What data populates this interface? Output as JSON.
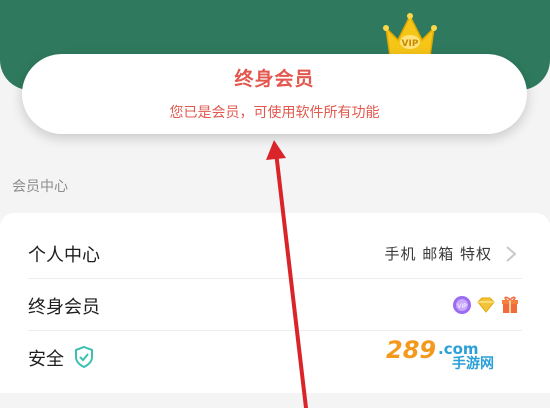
{
  "membership_card": {
    "title": "终身会员",
    "subtitle": "您已是会员，可使用软件所有功能"
  },
  "crown_badge": {
    "text": "VIP"
  },
  "section": {
    "label": "会员中心"
  },
  "rows": [
    {
      "label": "个人中心",
      "value": "手机 邮箱 特权",
      "icon": "chevron-right-icon"
    },
    {
      "label": "终身会员",
      "badges": [
        "vip-badge-icon",
        "diamond-badge-icon",
        "gift-badge-icon"
      ]
    },
    {
      "label": "安全",
      "icon": "shield-check-icon"
    }
  ],
  "watermark": {
    "logo_text": "289",
    "domain_text": ".com",
    "caption": "手游网"
  },
  "colors": {
    "brand_green": "#2f7a5e",
    "accent_red": "#e2584e",
    "crown_gold": "#f5c518",
    "shield_teal": "#3bbfb0",
    "annotation_arrow": "#d9252a"
  }
}
